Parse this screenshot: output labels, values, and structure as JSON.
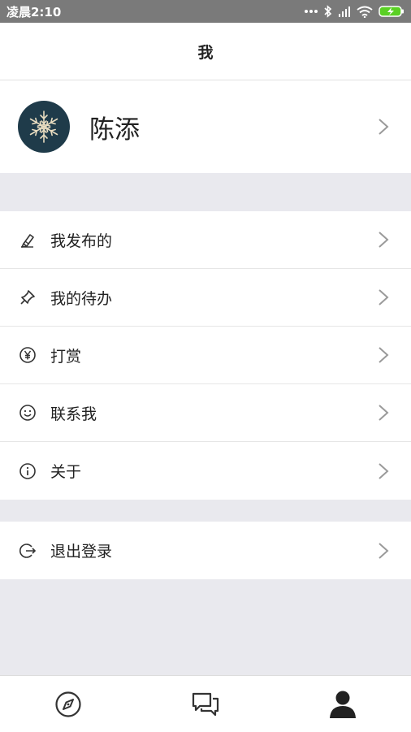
{
  "status_bar": {
    "time": "凌晨2:10"
  },
  "header": {
    "title": "我"
  },
  "profile": {
    "name": "陈添"
  },
  "menu": [
    {
      "label": "我发布的",
      "icon": "pen-icon"
    },
    {
      "label": "我的待办",
      "icon": "pin-icon"
    },
    {
      "label": "打赏",
      "icon": "yen-icon"
    },
    {
      "label": "联系我",
      "icon": "smile-icon"
    },
    {
      "label": "关于",
      "icon": "info-icon"
    }
  ],
  "logout": {
    "label": "退出登录",
    "icon": "logout-icon"
  },
  "tabs": [
    {
      "icon": "compass-icon"
    },
    {
      "icon": "chat-icon"
    },
    {
      "icon": "user-icon"
    }
  ],
  "colors": {
    "status_bar_bg": "#7a7a7a",
    "page_bg": "#e9e9ee",
    "battery": "#5ad024"
  }
}
